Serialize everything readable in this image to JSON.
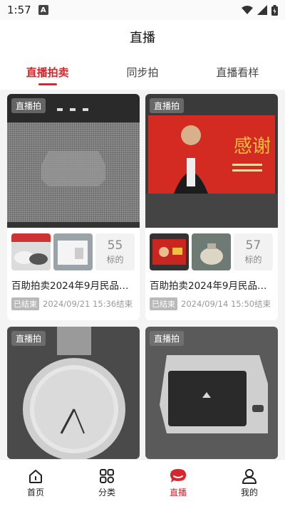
{
  "status_bar": {
    "time": "1:57",
    "notif_letter": "A"
  },
  "header": {
    "title": "直播"
  },
  "tabs": [
    {
      "label": "直播拍卖",
      "active": true
    },
    {
      "label": "同步拍",
      "active": false
    },
    {
      "label": "直播看样",
      "active": false
    }
  ],
  "cards": [
    {
      "badge": "直播拍",
      "count": "55",
      "count_label": "标的",
      "title": "百助拍卖2024年9月民品…",
      "status": "已结束",
      "end_time": "2024/09/21 15:36结束"
    },
    {
      "badge": "直播拍",
      "count": "57",
      "count_label": "标的",
      "title": "百助拍卖2024年9月民品…",
      "status": "已结束",
      "end_time": "2024/09/14 15:50结束",
      "image_text": "感谢"
    },
    {
      "badge": "直播拍"
    },
    {
      "badge": "直播拍"
    }
  ],
  "bottom_nav": [
    {
      "label": "首页",
      "icon": "home-icon",
      "active": false
    },
    {
      "label": "分类",
      "icon": "category-icon",
      "active": false
    },
    {
      "label": "直播",
      "icon": "live-icon",
      "active": true
    },
    {
      "label": "我的",
      "icon": "profile-icon",
      "active": false
    }
  ],
  "colors": {
    "accent": "#d9262c"
  }
}
